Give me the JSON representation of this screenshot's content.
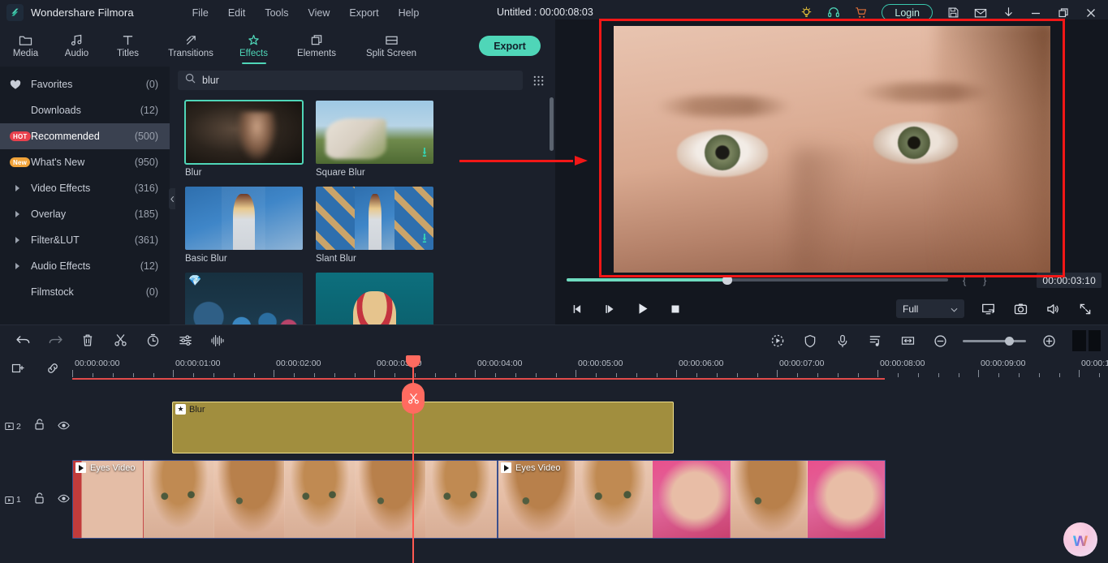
{
  "titlebar": {
    "app_name": "Wondershare Filmora",
    "logo_icon": "filmora-diamond-logo",
    "menus": [
      "File",
      "Edit",
      "Tools",
      "View",
      "Export",
      "Help"
    ],
    "project_title": "Untitled : 00:00:08:03",
    "login_label": "Login",
    "right_icons": [
      "lightbulb-idea-icon",
      "headset-support-icon",
      "shopping-cart-icon",
      "save-icon",
      "mail-icon",
      "download-icon",
      "minimize-icon",
      "restore-icon",
      "close-icon"
    ],
    "accent_color": "#4fd6b8",
    "title_bg": "#1b202b"
  },
  "topnav": {
    "tabs": [
      {
        "label": "Media",
        "icon": "folder-icon",
        "active": false
      },
      {
        "label": "Audio",
        "icon": "music-note-icon",
        "active": false
      },
      {
        "label": "Titles",
        "icon": "text-t-icon",
        "active": false
      },
      {
        "label": "Transitions",
        "icon": "transition-arrow-icon",
        "active": false
      },
      {
        "label": "Effects",
        "icon": "sparkle-star-icon",
        "active": true
      },
      {
        "label": "Elements",
        "icon": "layers-icon",
        "active": false
      },
      {
        "label": "Split Screen",
        "icon": "split-screen-icon",
        "active": false
      }
    ],
    "export_label": "Export"
  },
  "sidebar": {
    "items": [
      {
        "label": "Favorites",
        "count": "(0)",
        "icon": "heart-icon",
        "badge": "",
        "selected": false,
        "expandable": false
      },
      {
        "label": "Downloads",
        "count": "(12)",
        "icon": "",
        "badge": "",
        "selected": false,
        "expandable": false
      },
      {
        "label": "Recommended",
        "count": "(500)",
        "icon": "",
        "badge": "HOT",
        "selected": true,
        "expandable": false
      },
      {
        "label": "What's New",
        "count": "(950)",
        "icon": "",
        "badge": "New",
        "selected": false,
        "expandable": false
      },
      {
        "label": "Video Effects",
        "count": "(316)",
        "icon": "",
        "badge": "",
        "selected": false,
        "expandable": true
      },
      {
        "label": "Overlay",
        "count": "(185)",
        "icon": "",
        "badge": "",
        "selected": false,
        "expandable": true
      },
      {
        "label": "Filter&LUT",
        "count": "(361)",
        "icon": "",
        "badge": "",
        "selected": false,
        "expandable": true
      },
      {
        "label": "Audio Effects",
        "count": "(12)",
        "icon": "",
        "badge": "",
        "selected": false,
        "expandable": true
      },
      {
        "label": "Filmstock",
        "count": "(0)",
        "icon": "",
        "badge": "",
        "selected": false,
        "expandable": false
      }
    ]
  },
  "browser": {
    "search_value": "blur",
    "search_placeholder": "Search",
    "search_icon": "search-icon",
    "grid_view_icon": "grid-view-icon",
    "effects": [
      {
        "name": "Blur",
        "selected": true,
        "downloadable": false,
        "premium": false,
        "pic": "pic-blur"
      },
      {
        "name": "Square Blur",
        "selected": false,
        "downloadable": true,
        "premium": false,
        "pic": "pic-square"
      },
      {
        "name": "Basic Blur",
        "selected": false,
        "downloadable": false,
        "premium": false,
        "pic": "pic-basic"
      },
      {
        "name": "Slant Blur",
        "selected": false,
        "downloadable": true,
        "premium": false,
        "pic": "pic-slant"
      },
      {
        "name": "",
        "selected": false,
        "downloadable": false,
        "premium": true,
        "pic": "pic-bokeh"
      },
      {
        "name": "",
        "selected": false,
        "downloadable": false,
        "premium": false,
        "pic": "pic-teal"
      }
    ]
  },
  "preview": {
    "timecode": "00:00:03:10",
    "quality": "Full",
    "mark_in_icon": "mark-in-brace",
    "mark_out_icon": "mark-out-brace",
    "controls": [
      {
        "name": "prev-frame-button",
        "icon": "previous-frame-icon"
      },
      {
        "name": "next-frame-button",
        "icon": "next-frame-icon"
      },
      {
        "name": "play-button",
        "icon": "play-icon"
      },
      {
        "name": "stop-button",
        "icon": "stop-icon"
      }
    ],
    "right_controls": [
      {
        "name": "snapshot-to-pc-button",
        "icon": "monitor-icon"
      },
      {
        "name": "snapshot-button",
        "icon": "camera-icon"
      },
      {
        "name": "volume-button",
        "icon": "speaker-icon"
      },
      {
        "name": "fullscreen-button",
        "icon": "expand-arrows-icon"
      }
    ]
  },
  "timeline_toolbar": {
    "left_tools": [
      {
        "name": "undo-button",
        "icon": "undo-arrow-icon"
      },
      {
        "name": "redo-button",
        "icon": "redo-arrow-icon"
      },
      {
        "name": "delete-button",
        "icon": "trash-icon"
      },
      {
        "name": "split-button",
        "icon": "scissors-icon"
      },
      {
        "name": "speed-button",
        "icon": "stopwatch-icon"
      },
      {
        "name": "color-settings-button",
        "icon": "sliders-icon"
      },
      {
        "name": "audio-waveform-button",
        "icon": "waveform-icon"
      }
    ],
    "right_tools": [
      {
        "name": "motion-tracking-button",
        "icon": "motion-tracking-icon"
      },
      {
        "name": "stabilization-button",
        "icon": "shield-icon"
      },
      {
        "name": "record-voiceover-button",
        "icon": "microphone-icon"
      },
      {
        "name": "auto-beat-sync-button",
        "icon": "beat-sync-icon"
      },
      {
        "name": "fit-timeline-button",
        "icon": "fit-width-icon"
      },
      {
        "name": "zoom-out-button",
        "icon": "minus-circle-icon"
      },
      {
        "name": "zoom-in-button",
        "icon": "plus-circle-icon"
      }
    ]
  },
  "timeline": {
    "add_marker_icon": "add-marker-icon",
    "link_icon": "link-chain-icon",
    "ruler_labels": [
      "00:00:00:00",
      "00:00:01:00",
      "00:00:02:00",
      "00:00:03:00",
      "00:00:04:00",
      "00:00:05:00",
      "00:00:06:00",
      "00:00:07:00",
      "00:00:08:00",
      "00:00:09:00",
      "00:00:1"
    ],
    "playhead_position": "00:00:03:00",
    "split_icon": "scissors-icon",
    "tracks": [
      {
        "number": "2",
        "lock_icon": "unlocked-padlock-icon",
        "eye_icon": "eye-visible-icon"
      },
      {
        "number": "1",
        "lock_icon": "unlocked-padlock-icon",
        "eye_icon": "eye-visible-icon"
      }
    ],
    "effect_clip": {
      "label": "Blur",
      "badge_icon": "star-icon"
    },
    "video_clips": [
      {
        "label": "Eyes Video",
        "badge_icon": "play-icon"
      },
      {
        "label": "Eyes Video",
        "badge_icon": "play-icon"
      }
    ]
  },
  "annotations": {
    "highlight_box_color": "#f21717",
    "arrow_color": "#f21717",
    "watermark_letter": "w"
  }
}
